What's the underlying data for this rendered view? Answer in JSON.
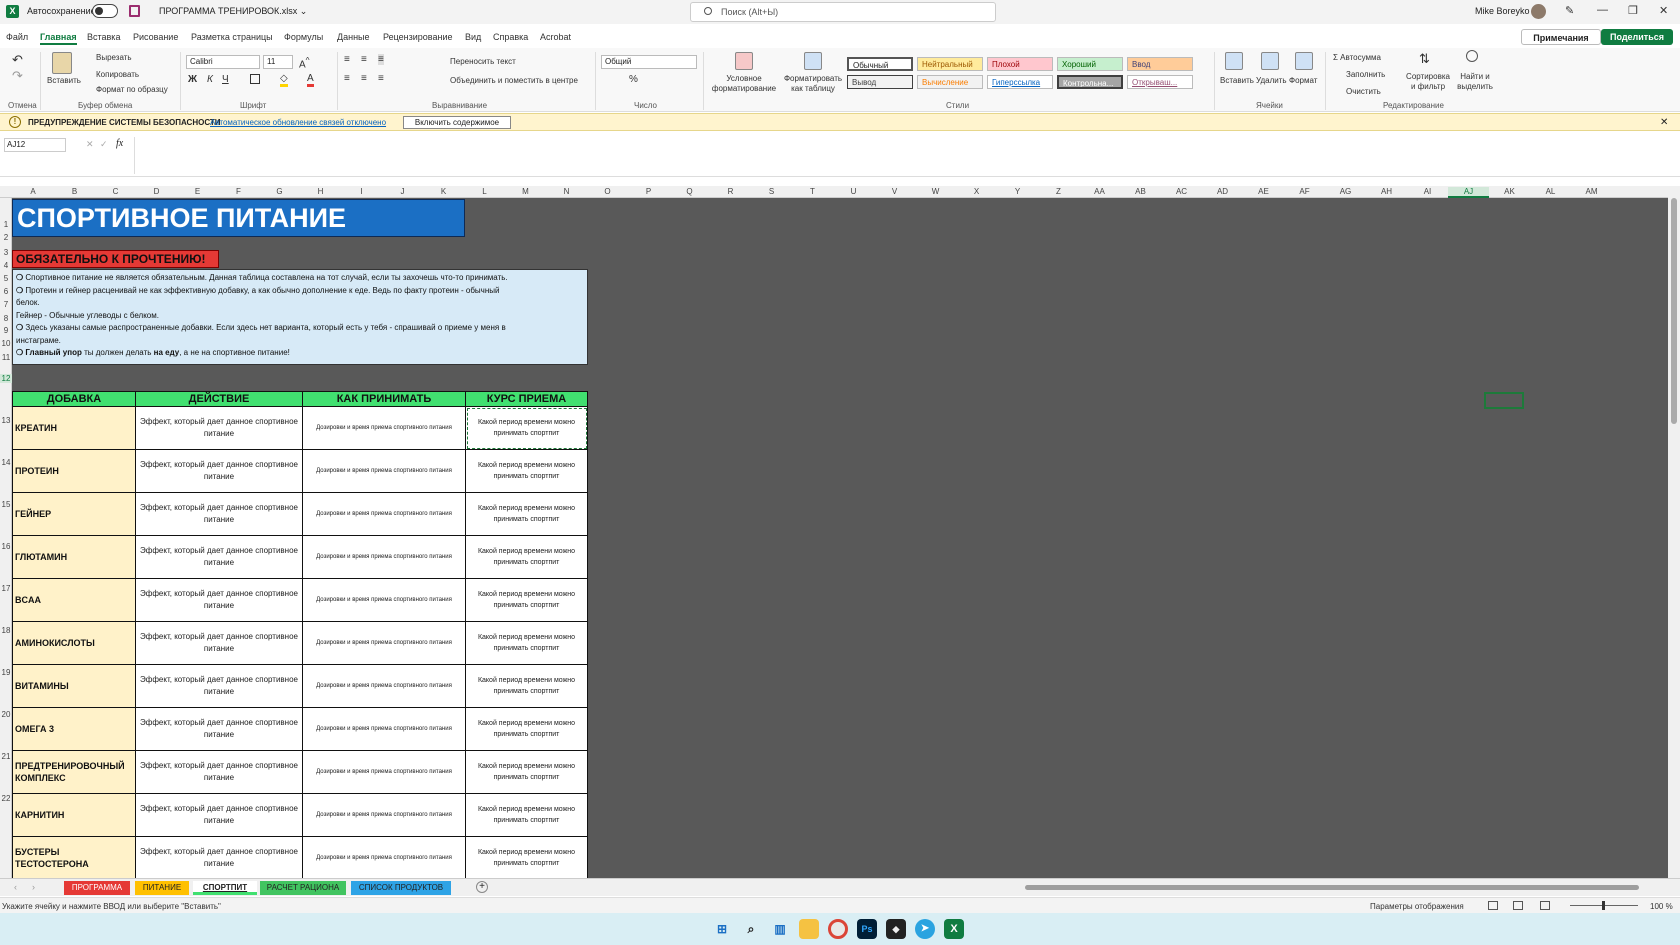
{
  "titlebar": {
    "autosave_label": "Автосохранение",
    "filename": "ПРОГРАММА ТРЕНИРОВОК.xlsx ⌄",
    "search_placeholder": "Поиск (Alt+Ы)",
    "user": "Mike Boreyko"
  },
  "menu": {
    "items": [
      "Файл",
      "Главная",
      "Вставка",
      "Рисование",
      "Разметка страницы",
      "Формулы",
      "Данные",
      "Рецензирование",
      "Вид",
      "Справка",
      "Acrobat"
    ],
    "comments": "Примечания",
    "share": "Поделиться"
  },
  "ribbon": {
    "clipboard": {
      "paste": "Вставить",
      "cut": "Вырезать",
      "copy": "Копировать",
      "format_painter": "Формат по образцу",
      "group": "Буфер обмена"
    },
    "undo": {
      "group": "Отмена"
    },
    "font": {
      "name": "Calibri",
      "size": "11",
      "group": "Шрифт"
    },
    "alignment": {
      "wrap": "Переносить текст",
      "merge": "Объединить и поместить в центре",
      "group": "Выравнивание"
    },
    "number": {
      "format": "Общий",
      "group": "Число"
    },
    "styles": {
      "cond": "Условное форматирование",
      "table": "Форматировать как таблицу",
      "group": "Стили",
      "cells": [
        "Обычный",
        "Нейтральный",
        "Плохой",
        "Хороший",
        "Ввод",
        "Вывод",
        "Вычисление",
        "Гиперссылка",
        "Контрольна...",
        "Открываш..."
      ]
    },
    "cells": {
      "insert": "Вставить",
      "delete": "Удалить",
      "format": "Формат",
      "group": "Ячейки"
    },
    "editing": {
      "autosum": "Автосумма",
      "fill": "Заполнить",
      "clear": "Очистить",
      "sort": "Сортировка и фильтр",
      "find": "Найти и выделить",
      "group": "Редактирование"
    }
  },
  "security": {
    "title": "ПРЕДУПРЕЖДЕНИЕ СИСТЕМЫ БЕЗОПАСНОСТИ",
    "message": "Автоматическое обновление связей отключено",
    "button": "Включить содержимое"
  },
  "formula": {
    "cell_ref": "AJ12",
    "fx": "fx",
    "value": ""
  },
  "columns": [
    "A",
    "B",
    "C",
    "D",
    "E",
    "F",
    "G",
    "H",
    "I",
    "J",
    "K",
    "L",
    "M",
    "N",
    "O",
    "P",
    "Q",
    "R",
    "S",
    "T",
    "U",
    "V",
    "W",
    "X",
    "Y",
    "Z",
    "AA",
    "AB",
    "AC",
    "AD",
    "AE",
    "AF",
    "AG",
    "AH",
    "AI",
    "AJ",
    "AK",
    "AL",
    "AM"
  ],
  "rows": [
    "1",
    "2",
    "3",
    "4",
    "5",
    "6",
    "7",
    "8",
    "9",
    "10",
    "11",
    "12",
    "13",
    "14",
    "15",
    "16",
    "17",
    "18",
    "19",
    "20",
    "21",
    "22"
  ],
  "sheet": {
    "title": "СПОРТИВНОЕ ПИТАНИЕ",
    "must_read": "ОБЯЗАТЕЛЬНО К ПРОЧТЕНИЮ!",
    "notes": {
      "l1": "Спортивное питание не является обязательным. Данная таблица составлена на тот случай, если ты захочешь что-то принимать.",
      "l2": "Протеин и гейнер расценивай не как эффективную добавку, а как обычно дополнение к еде. Ведь по факту протеин - обычный",
      "l3": "белок.",
      "l4": "Гейнер - Обычные углеводы с белком.",
      "l5": "Здесь указаны самые распространенные добавки. Если здесь нет варианта, который есть у тебя - спрашивай о приеме у меня в",
      "l6": "инстаграме.",
      "l7a": "Главный упор",
      "l7b": " ты должен делать ",
      "l7c": "на еду",
      "l7d": ", а не на спортивное питание!"
    },
    "headers": [
      "ДОБАВКА",
      "ДЕЙСТВИЕ",
      "КАК ПРИНИМАТЬ",
      "КУРС ПРИЕМА"
    ],
    "rows": [
      {
        "name": "КРЕАТИН",
        "effect": "Эффект, который дает данное спортивное питание",
        "how": "Дозировки и время приема спортивного питания",
        "course": "Какой период времени можно принимать спортпит"
      },
      {
        "name": "ПРОТЕИН",
        "effect": "Эффект, который дает данное спортивное питание",
        "how": "Дозировки и время приема спортивного питания",
        "course": "Какой период времени можно принимать спортпит"
      },
      {
        "name": "ГЕЙНЕР",
        "effect": "Эффект, который дает данное спортивное питание",
        "how": "Дозировки и время приема спортивного питания",
        "course": "Какой период времени можно принимать спортпит"
      },
      {
        "name": "ГЛЮТАМИН",
        "effect": "Эффект, который дает данное спортивное питание",
        "how": "Дозировки и время приема спортивного питания",
        "course": "Какой период времени можно принимать спортпит"
      },
      {
        "name": "BCAA",
        "effect": "Эффект, который дает данное спортивное питание",
        "how": "Дозировки и время приема спортивного питания",
        "course": "Какой период времени можно принимать спортпит"
      },
      {
        "name": "АМИНОКИСЛОТЫ",
        "effect": "Эффект, который дает данное спортивное питание",
        "how": "Дозировки и время приема спортивного питания",
        "course": "Какой период времени можно принимать спортпит"
      },
      {
        "name": "ВИТАМИНЫ",
        "effect": "Эффект, который дает данное спортивное питание",
        "how": "Дозировки и время приема спортивного питания",
        "course": "Какой период времени можно принимать спортпит"
      },
      {
        "name": "ОМЕГА 3",
        "effect": "Эффект, который дает данное спортивное питание",
        "how": "Дозировки и время приема спортивного питания",
        "course": "Какой период времени можно принимать спортпит"
      },
      {
        "name": "ПРЕДТРЕНИРОВОЧНЫЙ КОМПЛЕКС",
        "effect": "Эффект, который дает данное спортивное питание",
        "how": "Дозировки и время приема спортивного питания",
        "course": "Какой период времени можно принимать спортпит"
      },
      {
        "name": "КАРНИТИН",
        "effect": "Эффект, который дает данное спортивное питание",
        "how": "Дозировки и время приема спортивного питания",
        "course": "Какой период времени можно принимать спортпит"
      },
      {
        "name": "БУСТЕРЫ ТЕСТОСТЕРОНА",
        "effect": "Эффект, который дает данное спортивное питание",
        "how": "Дозировки и время приема спортивного питания",
        "course": "Какой период времени можно принимать спортпит"
      }
    ]
  },
  "tabs": [
    {
      "label": "ПРОГРАММА",
      "color": "#e53935"
    },
    {
      "label": "ПИТАНИЕ",
      "color": "#ffc000"
    },
    {
      "label": "СПОРТПИТ",
      "color": "#41e070"
    },
    {
      "label": "РАСЧЕТ РАЦИОНА",
      "color": "#41c460"
    },
    {
      "label": "СПИСОК ПРОДУКТОВ",
      "color": "#2ea3e6"
    }
  ],
  "status": {
    "hint": "Укажите ячейку и нажмите ВВОД или выберите \"Вставить\"",
    "display": "Параметры отображения",
    "zoom": "100 %"
  }
}
